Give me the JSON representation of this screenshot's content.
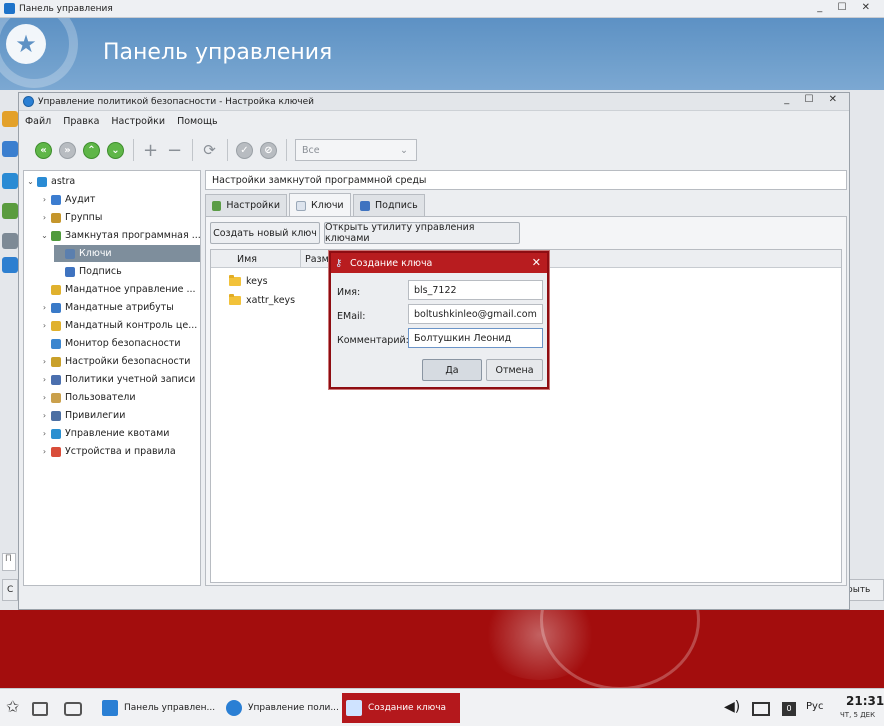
{
  "control_panel": {
    "window_title": "Панель управления",
    "header_title": "Панель управления",
    "search_placeholder": "П",
    "btn_left": "С",
    "btn_right": "рыть"
  },
  "security_window": {
    "title": "Управление политикой безопасности - Настройка ключей",
    "menu": [
      "Файл",
      "Правка",
      "Настройки",
      "Помощь"
    ],
    "filter_value": "Все",
    "tree": {
      "root": "astra",
      "items": [
        {
          "label": "Аудит",
          "color": "#3c7dd0"
        },
        {
          "label": "Группы",
          "color": "#c5962c"
        },
        {
          "label": "Замкнутая программная ...",
          "color": "#4f9a3c"
        },
        {
          "label": "Ключи",
          "color": "#5b7fae"
        },
        {
          "label": "Подпись",
          "color": "#3f73c0"
        },
        {
          "label": "Мандатное управление ...",
          "color": "#e0b12d"
        },
        {
          "label": "Мандатные атрибуты",
          "color": "#3a7ac8"
        },
        {
          "label": "Мандатный контроль це...",
          "color": "#e0b12d"
        },
        {
          "label": "Монитор безопасности",
          "color": "#3b86cf"
        },
        {
          "label": "Настройки безопасности",
          "color": "#c9a02a"
        },
        {
          "label": "Политики учетной записи",
          "color": "#4b6fae"
        },
        {
          "label": "Пользователи",
          "color": "#caa04c"
        },
        {
          "label": "Привилегии",
          "color": "#4c6fa3"
        },
        {
          "label": "Управление квотами",
          "color": "#2a8fd0"
        },
        {
          "label": "Устройства и правила",
          "color": "#d94d3a"
        }
      ]
    },
    "section_title": "Настройки замкнутой программной среды",
    "tabs": [
      "Настройки",
      "Ключи",
      "Подпись"
    ],
    "buttons": {
      "create_key": "Создать новый ключ",
      "open_utility": "Открыть утилиту управления ключами"
    },
    "table": {
      "columns": [
        "Имя",
        "Разме"
      ],
      "rows": [
        "keys",
        "xattr_keys"
      ]
    }
  },
  "dialog": {
    "title": "Создание ключа",
    "fields": [
      {
        "label": "Имя:",
        "value": "bls_7122"
      },
      {
        "label": "EMail:",
        "value": "boltushkinleo@gmail.com"
      },
      {
        "label": "Комментарий:",
        "value": "Болтушкин Леонид"
      }
    ],
    "ok": "Да",
    "cancel": "Отмена"
  },
  "taskbar": {
    "tasks": [
      "Панель управлен...",
      "Управление поли...",
      "Создание ключа"
    ],
    "lang": "Рус",
    "time": "21:31",
    "date": "ЧТ, 5 ДЕК"
  },
  "colors": {
    "accent_red": "#b81c1f",
    "desktop_red": "#a30d0d",
    "selection": "#7e8e9c"
  }
}
